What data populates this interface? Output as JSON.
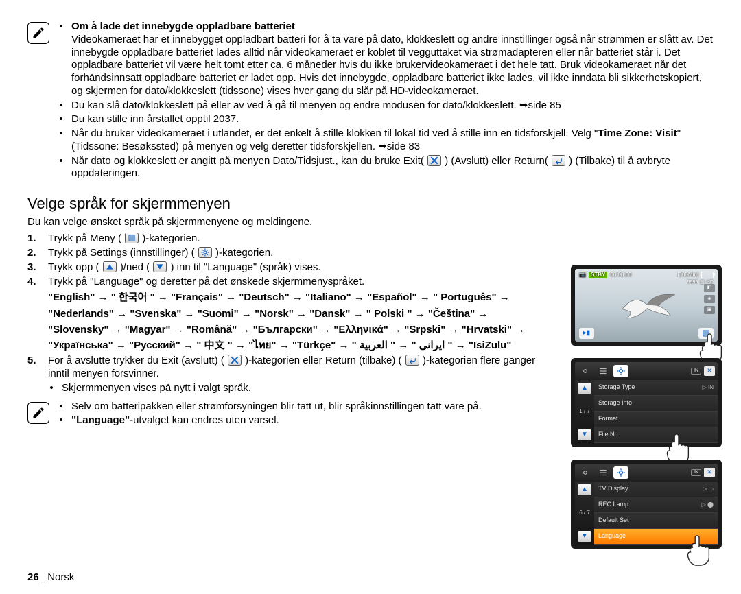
{
  "note1": {
    "title": "Om å lade det innebygde oppladbare batteriet",
    "b1": "Videokameraet har et innebygget oppladbart batteri for å ta vare på dato, klokkeslett og andre innstillinger også når strømmen er slått av. Det innebygde oppladbare batteriet lades alltid når videokameraet er koblet til vegguttaket via strømadapteren eller når batteriet står i. Det oppladbare batteriet vil være helt tomt etter ca. 6 måneder hvis du ikke brukervideokameraet i det hele tatt. Bruk videokameraet når det forhåndsinnsatt oppladbare batteriet er ladet opp. Hvis det innebygde, oppladbare batteriet ikke lades, vil ikke inndata bli sikkerhetskopiert, og skjermen for dato/klokkeslett (tidssone) vises hver gang du slår på HD-videokameraet.",
    "b2a": "Du kan slå dato/klokkeslett på eller av ved å gå til menyen og endre modusen for dato/klokkeslett. ",
    "b2b": "side 85",
    "b3": "Du kan stille inn årstallet opptil 2037.",
    "b4_1": "Når du bruker videokameraet i utlandet, er det enkelt å stille klokken til lokal tid ved å stille inn en tidsforskjell. Velg \"",
    "b4_bold": "Time Zone: Visit",
    "b4_2": "\" (Tidssone: Besøkssted) på menyen og velg deretter tidsforskjellen. ",
    "b4_3": "side 83",
    "b5_1": "Når dato og klokkeslett er angitt på menyen Dato/Tidsjust., kan du bruke Exit(",
    "b5_2": ") (Avslutt) eller Return(",
    "b5_3": ") (Tilbake) til å avbryte oppdateringen."
  },
  "section_title": "Velge språk for skjermmenyen",
  "intro": "Du kan velge ønsket språk på skjermmenyene og meldingene.",
  "steps": {
    "s1a": "Trykk på Meny (",
    "s1b": ")-kategorien.",
    "s2a": "Trykk på Settings (innstillinger) (",
    "s2b": ")-kategorien.",
    "s3a": "Trykk opp (",
    "s3b": ")/ned (",
    "s3c": ") inn til \"Language\" (språk) vises.",
    "s4": "Trykk på \"Language\" og deretter på det ønskede skjermmenyspråket.",
    "langs": "\"English\" → \" 한국어 \" → \"Français\" → \"Deutsch\" → \"Italiano\" → \"Español\" → \" Português\" → \"Nederlands\" → \"Svenska\" → \"Suomi\" → \"Norsk\" → \"Dansk\" → \" Polski \" → \"Čeština\" → \"Slovensky\" → \"Magyar\" → \"Română\" → \"Български\" → \"Ελληνικά\" → \"Srpski\" → \"Hrvatski\" → \"Українська\" → \"Русский\" → \" 中文 \" → \"ไทย\" → \"Türkçe\" → \" ایرانی \" → \" العربية \" → \"IsiZulu\"",
    "s5": {
      "a": "For å avslutte trykker du Exit (avslutt) (",
      "b": ")-kategorien eller Return (tilbake) (",
      "c": ")-kategorien flere ganger inntil menyen forsvinner."
    },
    "s5_sub": "Skjermmenyen vises på nytt i valgt språk."
  },
  "note2": {
    "b1": "Selv om batteripakken eller strømforsyningen blir tatt ut, blir språkinnstillingen tatt vare på.",
    "b2a": "\"Language\"",
    "b2b": "-utvalget kan endres uten varsel."
  },
  "footer": {
    "page": "26",
    "sep": "_ ",
    "lang": "Norsk"
  },
  "device1": {
    "stby": "STBY",
    "time": "00:00:00",
    "remain": "[300Min]",
    "count": "9999",
    "hd": "HD"
  },
  "menus": {
    "in_badge": "IN",
    "page1": "1 / 7",
    "page2": "6 / 7",
    "rows1": [
      {
        "label": "Storage Type",
        "val": "▷ IN"
      },
      {
        "label": "Storage Info",
        "val": ""
      },
      {
        "label": "Format",
        "val": ""
      },
      {
        "label": "File No.",
        "val": ""
      }
    ],
    "rows2": [
      {
        "label": "TV Display",
        "val": "▷ ▭"
      },
      {
        "label": "REC Lamp",
        "val": "▷ ⬤"
      },
      {
        "label": "Default Set",
        "val": ""
      },
      {
        "label": "Language",
        "val": "",
        "hl": true
      }
    ]
  }
}
